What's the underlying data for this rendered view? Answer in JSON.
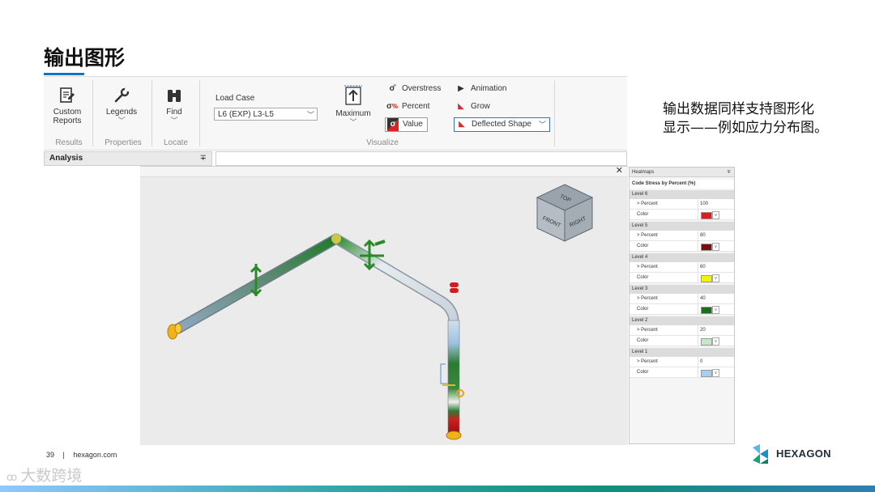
{
  "slide": {
    "title": "输出图形",
    "side_text": [
      "输出数据同样支持图形化",
      "显示——例如应力分布图。"
    ],
    "page_number": "39",
    "footer_sep": "|",
    "footer_site": "hexagon.com",
    "brand": "HEXAGON",
    "watermark": "大数跨境"
  },
  "ribbon": {
    "custom_reports": [
      "Custom",
      "Reports"
    ],
    "legends": "Legends",
    "find": "Find",
    "load_case_label": "Load Case",
    "load_case_value": "L6 (EXP) L3-L5",
    "maximum": "Maximum",
    "overstress": "Overstress",
    "percent": "Percent",
    "value": "Value",
    "animation": "Animation",
    "grow": "Grow",
    "deflected_shape": "Deflected Shape",
    "groups": {
      "results": "Results",
      "properties": "Properties",
      "locate": "Locate",
      "visualize": "Visualize"
    }
  },
  "analysis_tab": {
    "label": "Analysis",
    "pin": "∓"
  },
  "viewport": {
    "close": "✕",
    "view_cube": {
      "top": "TOP",
      "front": "FRONT",
      "right": "RIGHT"
    }
  },
  "heatmaps": {
    "title": "Heatmaps",
    "pin": "∓",
    "subtitle": "Code Stress by Percent (%)",
    "percent_label": "> Percent",
    "color_label": "Color",
    "levels": [
      {
        "name": "Level 6",
        "percent": "100",
        "color": "#e21c1c"
      },
      {
        "name": "Level 5",
        "percent": "80",
        "color": "#7a0f0f"
      },
      {
        "name": "Level 4",
        "percent": "60",
        "color": "#f2f20a"
      },
      {
        "name": "Level 3",
        "percent": "40",
        "color": "#1f6b1f"
      },
      {
        "name": "Level 2",
        "percent": "20",
        "color": "#c7e8c7"
      },
      {
        "name": "Level 1",
        "percent": "0",
        "color": "#a9cdee"
      }
    ]
  }
}
